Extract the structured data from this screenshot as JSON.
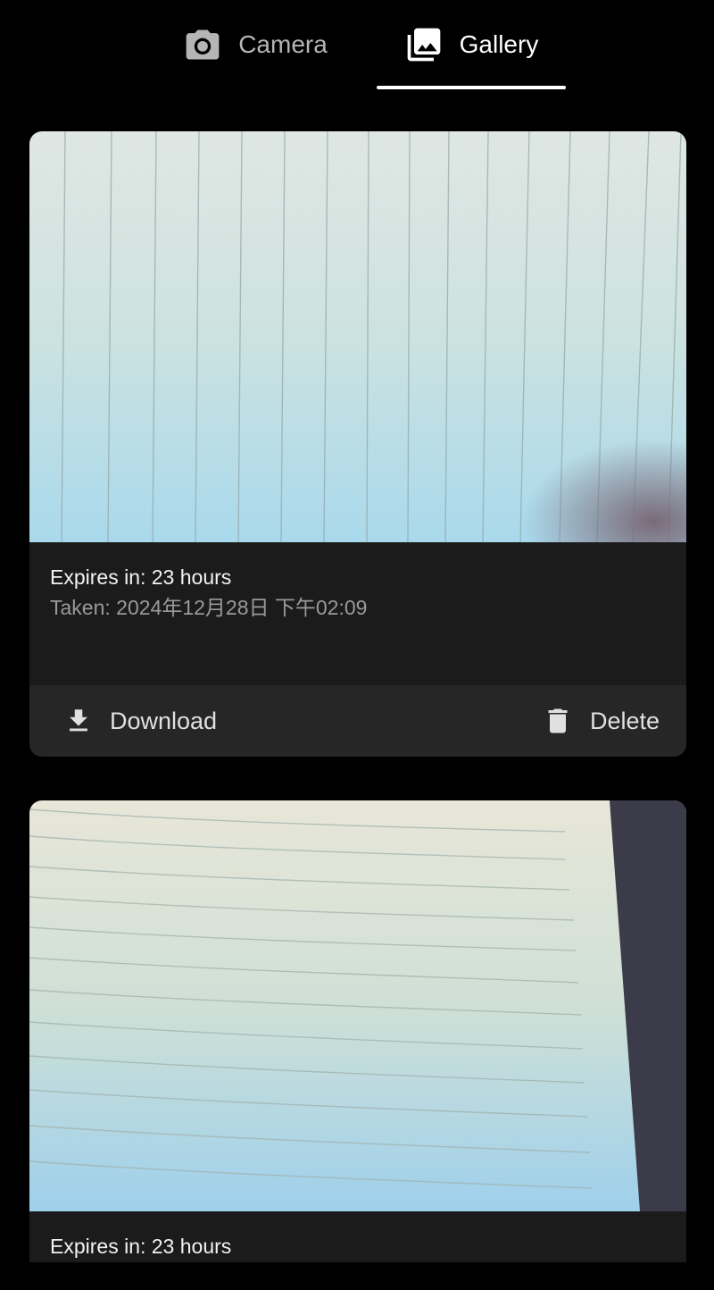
{
  "tabs": [
    {
      "label": "Camera",
      "icon": "camera-icon",
      "selected": false
    },
    {
      "label": "Gallery",
      "icon": "photo-library-icon",
      "selected": true
    }
  ],
  "photos": [
    {
      "expires": "Expires in: 23 hours",
      "taken": "Taken: 2024年12月28日 下午02:09",
      "download_label": "Download",
      "delete_label": "Delete"
    },
    {
      "expires": "Expires in: 23 hours"
    }
  ],
  "colors": {
    "background": "#000000",
    "card": "#1b1b1b",
    "action_bar": "#262626",
    "active_tab": "#ffffff",
    "inactive_tab": "#b5b5b5"
  }
}
